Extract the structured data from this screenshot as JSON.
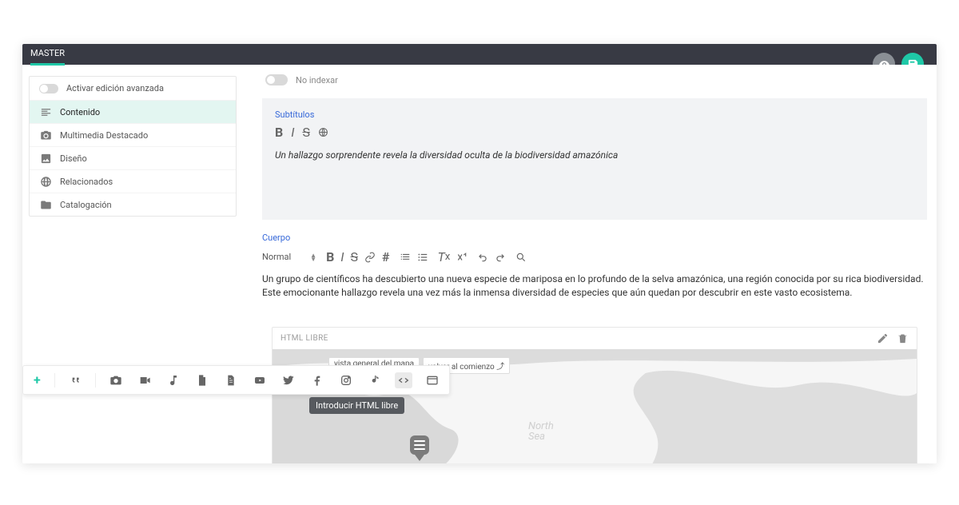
{
  "topbar": {
    "tab": "MASTER"
  },
  "sidebar": {
    "toggle_label": "Activar edición avanzada",
    "items": [
      {
        "icon": "align-left",
        "label": "Contenido",
        "active": true
      },
      {
        "icon": "camera",
        "label": "Multimedia Destacado"
      },
      {
        "icon": "image",
        "label": "Diseño"
      },
      {
        "icon": "globe",
        "label": "Relacionados"
      },
      {
        "icon": "folder",
        "label": "Catalogación"
      }
    ]
  },
  "noindex": {
    "label": "No indexar"
  },
  "subtitles": {
    "label": "Subtítulos",
    "text": "Un hallazgo sorprendente revela la diversidad oculta de la biodiversidad amazónica"
  },
  "body": {
    "label": "Cuerpo",
    "format": "Normal",
    "text": "Un grupo de científicos ha descubierto una nueva especie de mariposa en lo profundo de la selva amazónica, una región conocida por su rica biodiversidad. Este emocionante hallazgo revela una vez más la inmensa diversidad de especies que aún quedan por descubrir en este vasto ecosistema."
  },
  "tooltip": "Introducir HTML libre",
  "html_block": {
    "title": "HTML LIBRE"
  },
  "map": {
    "chip1": "vista general del mapa",
    "chip2": "volver al comienzo ⤴",
    "sea_l1": "North",
    "sea_l2": "Sea"
  }
}
